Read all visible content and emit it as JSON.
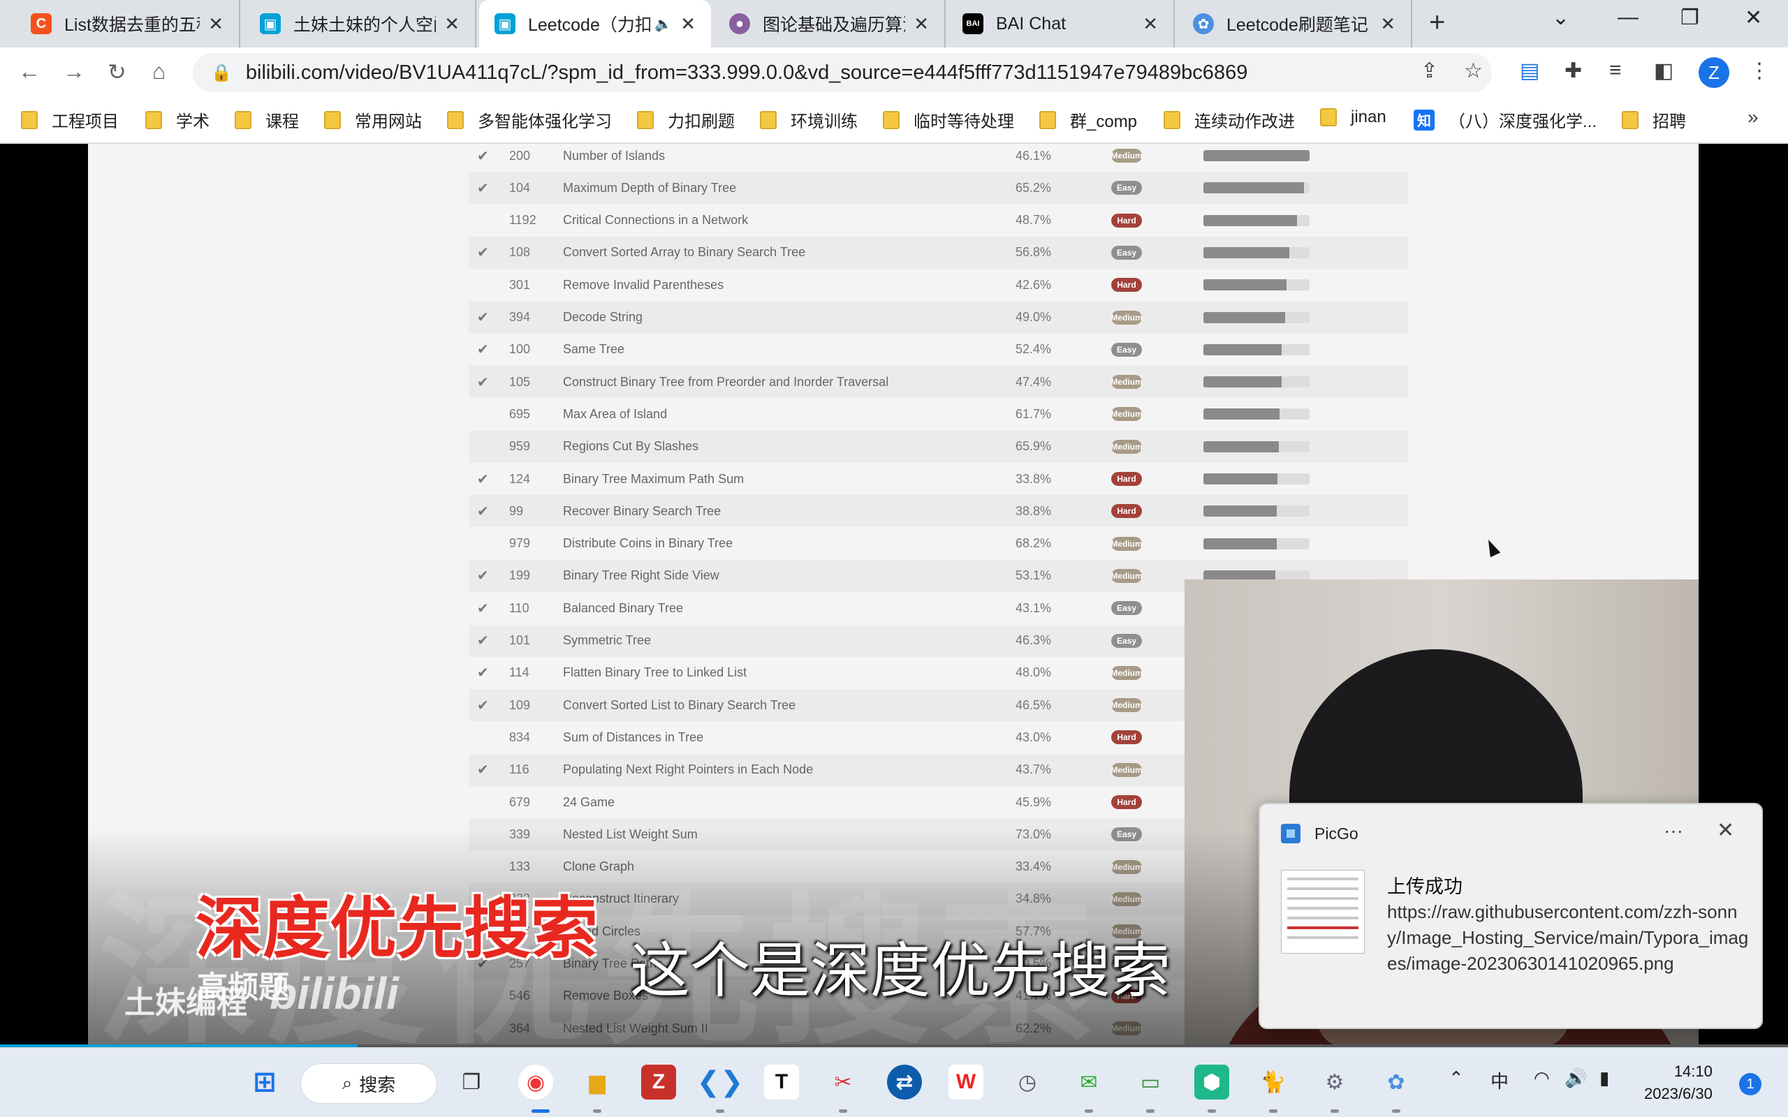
{
  "tabs": [
    {
      "title": "List数据去重的五种",
      "close": "✕",
      "icon": "C",
      "color": "#f4511e"
    },
    {
      "title": "土妹土妹的个人空间",
      "close": "✕",
      "icon": "▣",
      "color": "#00a1d6"
    },
    {
      "title": "Leetcode（力扣",
      "close": "✕",
      "icon": "▣",
      "color": "#00a1d6",
      "audio": "🔈"
    },
    {
      "title": "图论基础及遍历算法",
      "close": "✕",
      "icon": "●",
      "color": "#8a5fa0"
    },
    {
      "title": "BAI Chat",
      "close": "✕",
      "icon": "BAI",
      "color": "#000000"
    },
    {
      "title": "Leetcode刷题笔记",
      "close": "✕",
      "icon": "✿",
      "color": "#4a90e2"
    }
  ],
  "toolbar": {
    "url_host": "bilibili.com",
    "url_path": "/video/BV1UA411q7cL/?spm_id_from=333.999.0.0&vd_source=e444f5fff773d1151947e79489bc6869",
    "profile": "Z"
  },
  "bookmarks": [
    {
      "label": "工程项目",
      "type": "folder"
    },
    {
      "label": "学术",
      "type": "folder"
    },
    {
      "label": "课程",
      "type": "folder"
    },
    {
      "label": "常用网站",
      "type": "folder"
    },
    {
      "label": "多智能体强化学习",
      "type": "folder"
    },
    {
      "label": "力扣刷题",
      "type": "folder"
    },
    {
      "label": "环境训练",
      "type": "folder"
    },
    {
      "label": "临时等待处理",
      "type": "folder"
    },
    {
      "label": "群_comp",
      "type": "folder"
    },
    {
      "label": "连续动作改进",
      "type": "folder"
    },
    {
      "label": "jinan",
      "type": "folder"
    },
    {
      "label": "（八）深度强化学...",
      "type": "zhihu",
      "badge": "知"
    },
    {
      "label": "招聘",
      "type": "folder"
    }
  ],
  "bookmarks_more": "»",
  "leetcode": [
    {
      "done": true,
      "num": "200",
      "title": "Number of Islands",
      "acc": "46.1%",
      "diff": "Medium",
      "freq": 100
    },
    {
      "done": true,
      "num": "104",
      "title": "Maximum Depth of Binary Tree",
      "acc": "65.2%",
      "diff": "Easy",
      "freq": 95
    },
    {
      "done": false,
      "num": "1192",
      "title": "Critical Connections in a Network",
      "acc": "48.7%",
      "diff": "Hard",
      "freq": 88
    },
    {
      "done": true,
      "num": "108",
      "title": "Convert Sorted Array to Binary Search Tree",
      "acc": "56.8%",
      "diff": "Easy",
      "freq": 81
    },
    {
      "done": false,
      "num": "301",
      "title": "Remove Invalid Parentheses",
      "acc": "42.6%",
      "diff": "Hard",
      "freq": 78
    },
    {
      "done": true,
      "num": "394",
      "title": "Decode String",
      "acc": "49.0%",
      "diff": "Medium",
      "freq": 77
    },
    {
      "done": true,
      "num": "100",
      "title": "Same Tree",
      "acc": "52.4%",
      "diff": "Easy",
      "freq": 74
    },
    {
      "done": true,
      "num": "105",
      "title": "Construct Binary Tree from Preorder and Inorder Traversal",
      "acc": "47.4%",
      "diff": "Medium",
      "freq": 74
    },
    {
      "done": false,
      "num": "695",
      "title": "Max Area of Island",
      "acc": "61.7%",
      "diff": "Medium",
      "freq": 72
    },
    {
      "done": false,
      "num": "959",
      "title": "Regions Cut By Slashes",
      "acc": "65.9%",
      "diff": "Medium",
      "freq": 71
    },
    {
      "done": true,
      "num": "124",
      "title": "Binary Tree Maximum Path Sum",
      "acc": "33.8%",
      "diff": "Hard",
      "freq": 70
    },
    {
      "done": true,
      "num": "99",
      "title": "Recover Binary Search Tree",
      "acc": "38.8%",
      "diff": "Hard",
      "freq": 69
    },
    {
      "done": false,
      "num": "979",
      "title": "Distribute Coins in Binary Tree",
      "acc": "68.2%",
      "diff": "Medium",
      "freq": 69
    },
    {
      "done": true,
      "num": "199",
      "title": "Binary Tree Right Side View",
      "acc": "53.1%",
      "diff": "Medium",
      "freq": 68
    },
    {
      "done": true,
      "num": "110",
      "title": "Balanced Binary Tree",
      "acc": "43.1%",
      "diff": "Easy",
      "freq": 0
    },
    {
      "done": true,
      "num": "101",
      "title": "Symmetric Tree",
      "acc": "46.3%",
      "diff": "Easy",
      "freq": 0
    },
    {
      "done": true,
      "num": "114",
      "title": "Flatten Binary Tree to Linked List",
      "acc": "48.0%",
      "diff": "Medium",
      "freq": 0
    },
    {
      "done": true,
      "num": "109",
      "title": "Convert Sorted List to Binary Search Tree",
      "acc": "46.5%",
      "diff": "Medium",
      "freq": 0
    },
    {
      "done": false,
      "num": "834",
      "title": "Sum of Distances in Tree",
      "acc": "43.0%",
      "diff": "Hard",
      "freq": 0
    },
    {
      "done": true,
      "num": "116",
      "title": "Populating Next Right Pointers in Each Node",
      "acc": "43.7%",
      "diff": "Medium",
      "freq": 0
    },
    {
      "done": false,
      "num": "679",
      "title": "24 Game",
      "acc": "45.9%",
      "diff": "Hard",
      "freq": 0
    },
    {
      "done": false,
      "num": "339",
      "title": "Nested List Weight Sum",
      "acc": "73.0%",
      "diff": "Easy",
      "freq": 0
    },
    {
      "done": false,
      "num": "133",
      "title": "Clone Graph",
      "acc": "33.4%",
      "diff": "Medium",
      "freq": 0
    },
    {
      "done": false,
      "num": "332",
      "title": "Reconstruct Itinerary",
      "acc": "34.8%",
      "diff": "Medium",
      "freq": 0
    },
    {
      "done": false,
      "num": "547",
      "title": "Friend Circles",
      "acc": "57.7%",
      "diff": "Medium",
      "freq": 0
    },
    {
      "done": true,
      "num": "257",
      "title": "Binary Tree Paths",
      "acc": "50.5%",
      "diff": "Easy",
      "freq": 0
    },
    {
      "done": false,
      "num": "546",
      "title": "Remove Boxes",
      "acc": "41.7%",
      "diff": "Hard",
      "freq": 0
    },
    {
      "done": false,
      "num": "364",
      "title": "Nested List Weight Sum II",
      "acc": "62.2%",
      "diff": "Medium",
      "freq": 0
    }
  ],
  "difficulty_colors": {
    "Easy": "#8f8f8f",
    "Medium": "#a79a86",
    "Hard": "#a3423a"
  },
  "video": {
    "ghost_text": "深度优先搜索",
    "red_title": "深度优先搜索",
    "subtitle": "这个是深度优先搜索",
    "watermark_a": "土妹编程",
    "watermark_b": "高频题",
    "watermark_logo": "bilibili",
    "progress": 0.2
  },
  "toast": {
    "app": "PicGo",
    "more": "···",
    "close": "✕",
    "heading": "上传成功",
    "message": "https://raw.githubusercontent.com/zzh-sonny/Image_Hosting_Service/main/Typora_images/image-20230630141020965.png"
  },
  "taskbar": {
    "search_label": "搜索",
    "time": "14:10",
    "date": "2023/6/30",
    "notifications": "1",
    "ime": "中"
  }
}
